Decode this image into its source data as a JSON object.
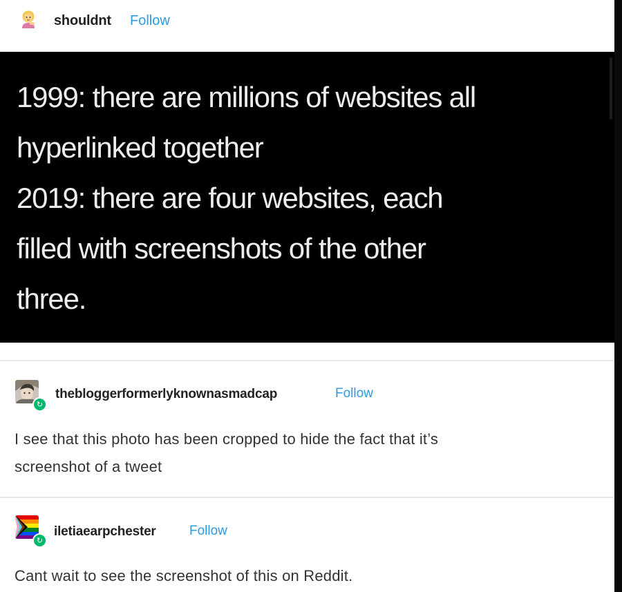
{
  "original_post": {
    "username": "shouldnt",
    "follow_label": "Follow",
    "avatar_icon": "person-emoji-icon",
    "image_text_lines": [
      "1999: there are millions of websites all",
      "hyperlinked together",
      "2019: there are four websites, each",
      "filled with screenshots of the other",
      "three."
    ]
  },
  "reblogs": [
    {
      "username": "thebloggerformerlyknownasmadcap",
      "follow_label": "Follow",
      "avatar_icon": "user-avatar-icon",
      "badge_icon": "reblog-icon",
      "text_lines": [
        "I see that this photo has been cropped to hide the fact that it’s",
        "screenshot of a tweet"
      ]
    },
    {
      "username": "iletiaearpchester",
      "follow_label": "Follow",
      "avatar_icon": "progress-pride-flag-icon",
      "badge_icon": "reblog-icon",
      "text_lines": [
        "Cant wait to see the screenshot of this on Reddit."
      ]
    }
  ],
  "colors": {
    "follow": "#2b9be4",
    "post_background": "#000000",
    "reblog_badge": "#00b86b"
  }
}
